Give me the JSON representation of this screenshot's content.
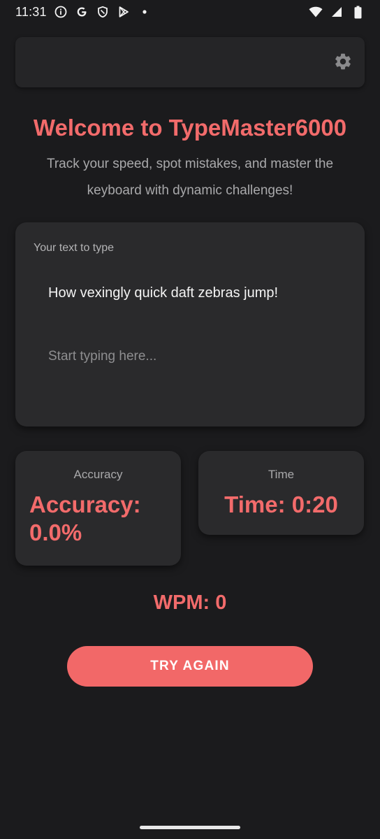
{
  "status_bar": {
    "time": "11:31",
    "left_icons": [
      "info-icon",
      "google-icon",
      "shield-icon",
      "play-store-icon",
      "dot-icon"
    ],
    "right_icons": [
      "wifi-icon",
      "cellular-signal-icon",
      "battery-icon"
    ]
  },
  "top_bar": {
    "settings_icon": "gear-icon"
  },
  "welcome": {
    "title": "Welcome to TypeMaster6000",
    "subtitle": "Track your speed, spot mistakes, and master the keyboard with dynamic challenges!"
  },
  "typing_card": {
    "label": "Your text to type",
    "target_text": "How vexingly quick daft zebras jump!",
    "input_value": "",
    "input_placeholder": "Start typing here..."
  },
  "stats": {
    "accuracy_label": "Accuracy",
    "accuracy_value": "Accuracy: 0.0%",
    "time_label": "Time",
    "time_value": "Time: 0:20",
    "wpm": "WPM: 0"
  },
  "actions": {
    "try_again_label": "TRY AGAIN"
  },
  "colors": {
    "background": "#1b1b1d",
    "card": "#2a2a2c",
    "accent": "#f26b6b",
    "muted_text": "#a9a9ab"
  }
}
